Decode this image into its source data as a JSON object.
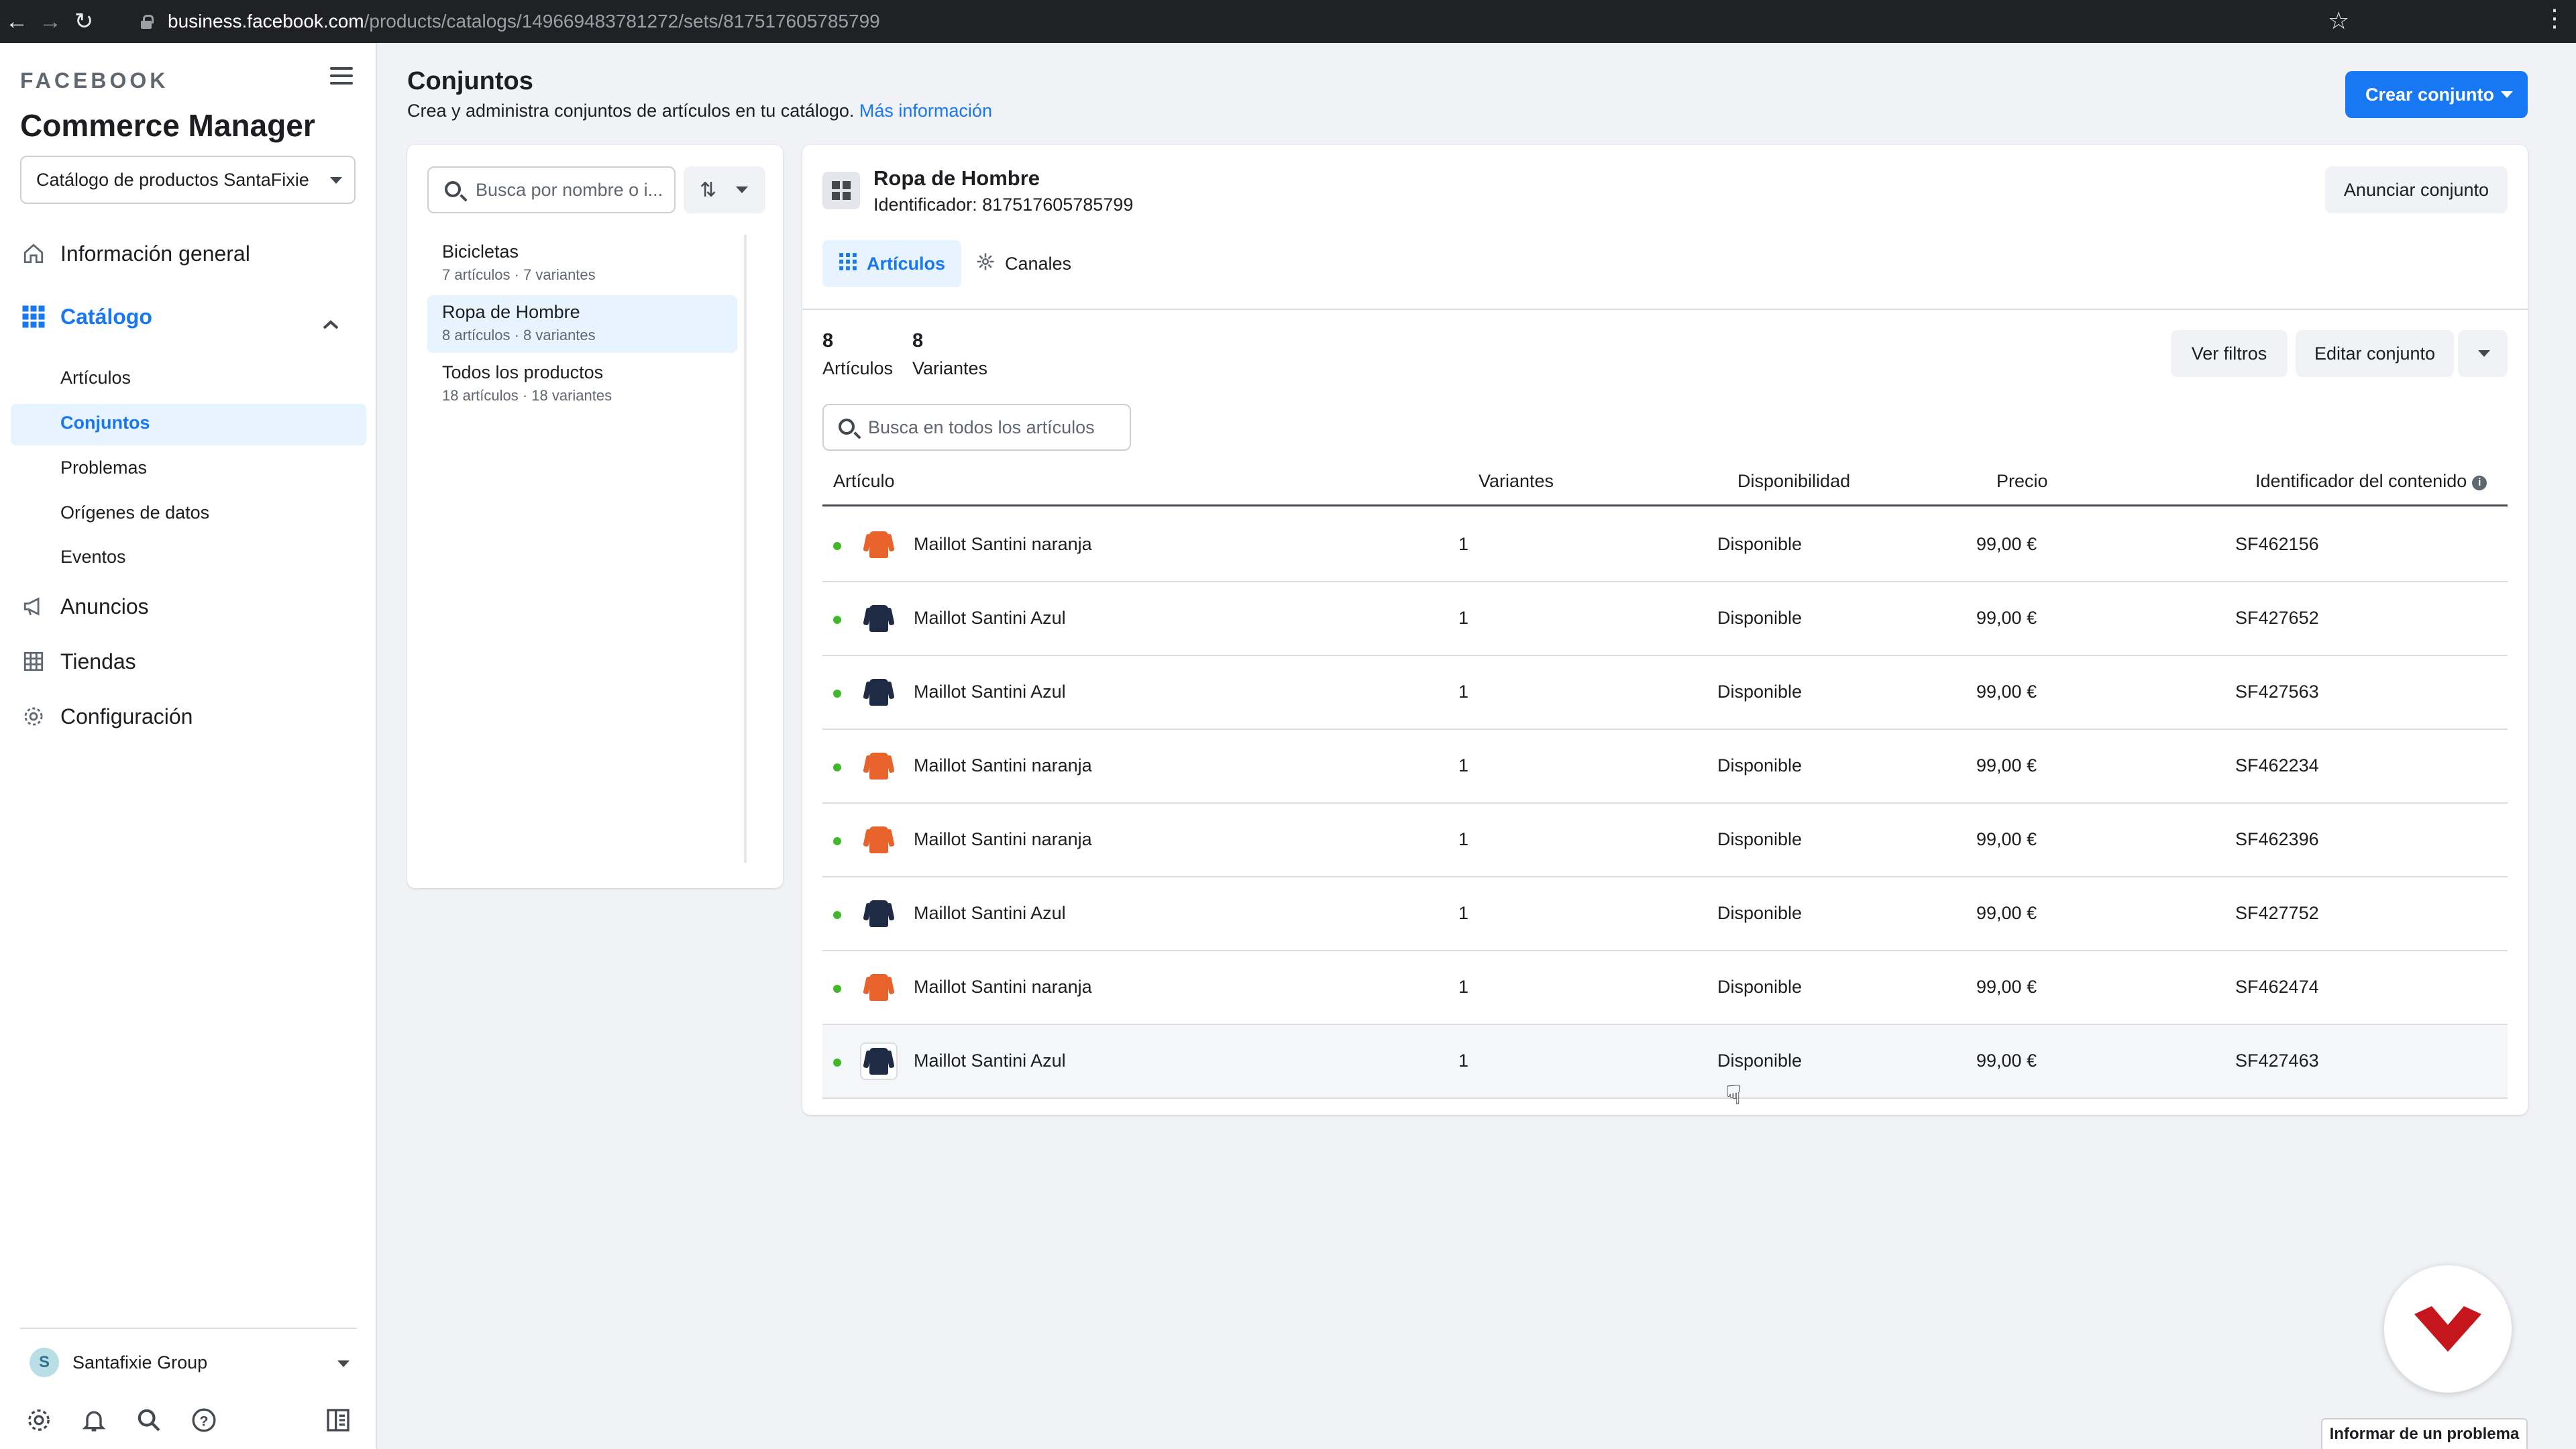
{
  "browser": {
    "url_host": "business.facebook.com",
    "url_path": "/products/catalogs/149669483781272/sets/817517605785799"
  },
  "sidebar": {
    "brand": "FACEBOOK",
    "title": "Commerce Manager",
    "catalog_selector": "Catálogo de productos SantaFixie",
    "nav": [
      {
        "label": "Información general",
        "icon": "home-icon"
      },
      {
        "label": "Catálogo",
        "icon": "grid-icon",
        "active": true
      },
      {
        "label": "Anuncios",
        "icon": "megaphone-icon"
      },
      {
        "label": "Tiendas",
        "icon": "store-icon"
      },
      {
        "label": "Configuración",
        "icon": "gear-icon"
      }
    ],
    "catalog_sub": [
      "Artículos",
      "Conjuntos",
      "Problemas",
      "Orígenes de datos",
      "Eventos"
    ],
    "active_sub": "Conjuntos",
    "business": {
      "initial": "S",
      "name": "Santafixie Group"
    }
  },
  "header": {
    "title": "Conjuntos",
    "subtitle": "Crea y administra conjuntos de artículos en tu catálogo.",
    "learn_more": "Más información",
    "create_button": "Crear conjunto"
  },
  "sets": {
    "search_placeholder": "Busca por nombre o i...",
    "items": [
      {
        "name": "Bicicletas",
        "meta": "7 artículos · 7 variantes"
      },
      {
        "name": "Ropa de Hombre",
        "meta": "8 artículos · 8 variantes"
      },
      {
        "name": "Todos los productos",
        "meta": "18 artículos · 18 variantes"
      }
    ],
    "selected": "Ropa de Hombre"
  },
  "detail": {
    "name": "Ropa de Hombre",
    "id_text": "Identificador: 817517605785799",
    "promote_button": "Anunciar conjunto",
    "tabs": [
      "Artículos",
      "Canales"
    ],
    "stats": [
      {
        "value": "8",
        "label": "Artículos"
      },
      {
        "value": "8",
        "label": "Variantes"
      }
    ],
    "view_filters": "Ver filtros",
    "edit_set": "Editar conjunto",
    "search_placeholder": "Busca en todos los artículos",
    "columns": [
      "Artículo",
      "Variantes",
      "Disponibilidad",
      "Precio",
      "Identificador del contenido"
    ],
    "rows": [
      {
        "name": "Maillot Santini naranja",
        "variants": "1",
        "availability": "Disponible",
        "price": "99,00 €",
        "content_id": "SF462156",
        "color": "#e8622c"
      },
      {
        "name": "Maillot Santini Azul",
        "variants": "1",
        "availability": "Disponible",
        "price": "99,00 €",
        "content_id": "SF427652",
        "color": "#1f2a44"
      },
      {
        "name": "Maillot Santini Azul",
        "variants": "1",
        "availability": "Disponible",
        "price": "99,00 €",
        "content_id": "SF427563",
        "color": "#1f2a44"
      },
      {
        "name": "Maillot Santini naranja",
        "variants": "1",
        "availability": "Disponible",
        "price": "99,00 €",
        "content_id": "SF462234",
        "color": "#e8622c"
      },
      {
        "name": "Maillot Santini naranja",
        "variants": "1",
        "availability": "Disponible",
        "price": "99,00 €",
        "content_id": "SF462396",
        "color": "#e8622c"
      },
      {
        "name": "Maillot Santini Azul",
        "variants": "1",
        "availability": "Disponible",
        "price": "99,00 €",
        "content_id": "SF427752",
        "color": "#1f2a44"
      },
      {
        "name": "Maillot Santini naranja",
        "variants": "1",
        "availability": "Disponible",
        "price": "99,00 €",
        "content_id": "SF462474",
        "color": "#e8622c"
      },
      {
        "name": "Maillot Santini Azul",
        "variants": "1",
        "availability": "Disponible",
        "price": "99,00 €",
        "content_id": "SF427463",
        "color": "#1f2a44"
      }
    ]
  },
  "footer": {
    "report_button": "Informar de un problema"
  },
  "colors": {
    "accent": "#1877f2",
    "status_available": "#42b72a",
    "logo_red": "#c4161c"
  }
}
